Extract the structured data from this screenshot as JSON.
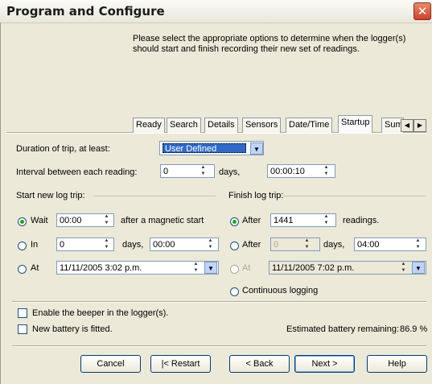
{
  "window": {
    "title": "Program and Configure"
  },
  "intro_text": "Please select the appropriate options to determine when the logger(s) should start and finish recording their new set of readings.",
  "tabs": [
    {
      "label": "Ready"
    },
    {
      "label": "Search"
    },
    {
      "label": "Details"
    },
    {
      "label": "Sensors"
    },
    {
      "label": "Date/Time"
    },
    {
      "label": "Startup"
    },
    {
      "label": "Sum"
    }
  ],
  "active_tab": "Startup",
  "duration": {
    "label": "Duration of trip, at least:",
    "value": "User Defined"
  },
  "interval": {
    "label": "Interval between each reading:",
    "days_value": "0",
    "days_unit": "days,",
    "time_value": "00:00:10"
  },
  "start": {
    "group_label": "Start new log trip:",
    "wait": {
      "label": "Wait",
      "value": "00:00",
      "suffix": "after a magnetic start",
      "selected": true
    },
    "in": {
      "label": "In",
      "days_value": "0",
      "days_unit": "days,",
      "time_value": "00:00",
      "selected": false
    },
    "at": {
      "label": "At",
      "value": "11/11/2005   3:02 p.m.",
      "selected": false
    }
  },
  "finish": {
    "group_label": "Finish log trip:",
    "after_readings": {
      "label": "After",
      "value": "1441",
      "suffix": "readings.",
      "selected": true
    },
    "after_days": {
      "label": "After",
      "days_value": "0",
      "days_unit": "days,",
      "time_value": "04:00",
      "selected": false
    },
    "at": {
      "label": "At",
      "value": "11/11/2005   7:02 p.m.",
      "selected": false
    },
    "continuous": {
      "label": "Continuous logging",
      "selected": false
    }
  },
  "options": {
    "beeper": {
      "label": "Enable the beeper in the logger(s).",
      "checked": false
    },
    "battery": {
      "label": "New battery is fitted.",
      "checked": false
    }
  },
  "battery_status": {
    "label": "Estimated battery remaining:",
    "value": "86.9 %"
  },
  "buttons": {
    "cancel": "Cancel",
    "restart": "|< Restart",
    "back": "< Back",
    "next": "Next >",
    "help": "Help"
  },
  "icons": {
    "close": "close-icon",
    "tab_left": "arrow-left-icon",
    "tab_right": "arrow-right-icon",
    "spin": "spin-arrows-icon",
    "dropdown": "chevron-down-icon"
  }
}
